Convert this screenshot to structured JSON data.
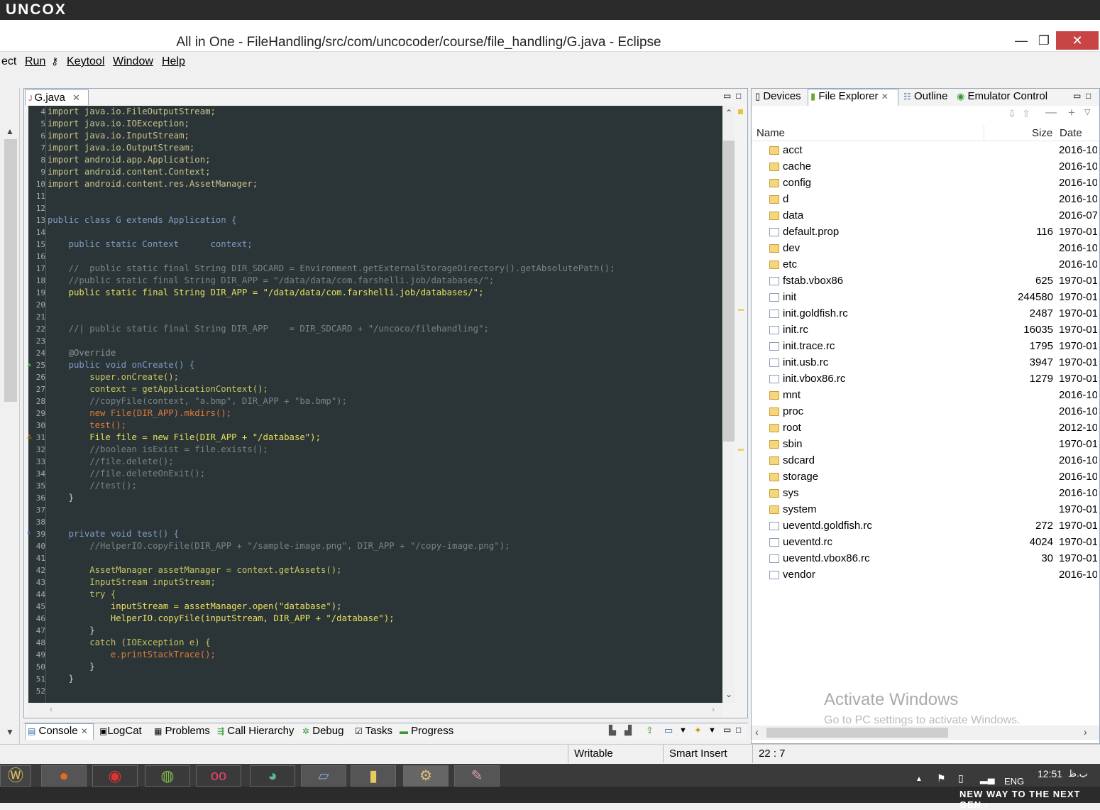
{
  "brand": "uncox",
  "window": {
    "title": "All in One - FileHandling/src/com/uncocoder/course/file_handling/G.java - Eclipse",
    "minimize": "—",
    "maximize": "❐",
    "close": "✕"
  },
  "menu": [
    "ect",
    "Run",
    "Keytool",
    "Window",
    "Help"
  ],
  "editor": {
    "tab_label": "G.java",
    "lines": [
      {
        "n": "4",
        "t": "import java.io.FileOutputStream;"
      },
      {
        "n": "5",
        "t": "import java.io.IOException;"
      },
      {
        "n": "6",
        "t": "import java.io.InputStream;"
      },
      {
        "n": "7",
        "t": "import java.io.OutputStream;"
      },
      {
        "n": "8",
        "t": "import android.app.Application;"
      },
      {
        "n": "9",
        "t": "import android.content.Context;"
      },
      {
        "n": "10",
        "t": "import android.content.res.AssetManager;"
      },
      {
        "n": "11",
        "t": ""
      },
      {
        "n": "12",
        "t": ""
      },
      {
        "n": "13",
        "t": "public class G extends Application {"
      },
      {
        "n": "14",
        "t": ""
      },
      {
        "n": "15",
        "t": "    public static Context      context;"
      },
      {
        "n": "16",
        "t": ""
      },
      {
        "n": "17",
        "t": "    //  public static final String DIR_SDCARD = Environment.getExternalStorageDirectory().getAbsolutePath();"
      },
      {
        "n": "18",
        "t": "    //public static final String DIR_APP = \"/data/data/com.farshelli.job/databases/\";"
      },
      {
        "n": "19",
        "t": "    public static final String DIR_APP = \"/data/data/com.farshelli.job/databases/\";"
      },
      {
        "n": "20",
        "t": ""
      },
      {
        "n": "21",
        "t": ""
      },
      {
        "n": "22",
        "t": "    //| public static final String DIR_APP    = DIR_SDCARD + \"/uncoco/filehandling\";"
      },
      {
        "n": "23",
        "t": ""
      },
      {
        "n": "24",
        "t": "    @Override"
      },
      {
        "n": "25",
        "t": "    public void onCreate() {"
      },
      {
        "n": "26",
        "t": "        super.onCreate();"
      },
      {
        "n": "27",
        "t": "        context = getApplicationContext();"
      },
      {
        "n": "28",
        "t": "        //copyFile(context, \"a.bmp\", DIR_APP + \"ba.bmp\");"
      },
      {
        "n": "29",
        "t": "        new File(DIR_APP).mkdirs();"
      },
      {
        "n": "30",
        "t": "        test();"
      },
      {
        "n": "31",
        "t": "        File file = new File(DIR_APP + \"/database\");"
      },
      {
        "n": "32",
        "t": "        //boolean isExist = file.exists();"
      },
      {
        "n": "33",
        "t": "        //file.delete();"
      },
      {
        "n": "34",
        "t": "        //file.deleteOnExit();"
      },
      {
        "n": "35",
        "t": "        //test();"
      },
      {
        "n": "36",
        "t": "    }"
      },
      {
        "n": "37",
        "t": ""
      },
      {
        "n": "38",
        "t": ""
      },
      {
        "n": "39",
        "t": "    private void test() {"
      },
      {
        "n": "40",
        "t": "        //HelperIO.copyFile(DIR_APP + \"/sample-image.png\", DIR_APP + \"/copy-image.png\");"
      },
      {
        "n": "41",
        "t": ""
      },
      {
        "n": "42",
        "t": "        AssetManager assetManager = context.getAssets();"
      },
      {
        "n": "43",
        "t": "        InputStream inputStream;"
      },
      {
        "n": "44",
        "t": "        try {"
      },
      {
        "n": "45",
        "t": "            inputStream = assetManager.open(\"database\");"
      },
      {
        "n": "46",
        "t": "            HelperIO.copyFile(inputStream, DIR_APP + \"/database\");"
      },
      {
        "n": "47",
        "t": "        }"
      },
      {
        "n": "48",
        "t": "        catch (IOException e) {"
      },
      {
        "n": "49",
        "t": "            e.printStackTrace();"
      },
      {
        "n": "50",
        "t": "        }"
      },
      {
        "n": "51",
        "t": "    }"
      },
      {
        "n": "52",
        "t": ""
      }
    ]
  },
  "right_tabs": [
    "Devices",
    "File Explorer",
    "Outline",
    "Emulator Control"
  ],
  "file_explorer": {
    "columns": [
      "Name",
      "Size",
      "Date"
    ],
    "rows": [
      {
        "name": "acct",
        "size": "",
        "date": "2016-10",
        "type": "folder"
      },
      {
        "name": "cache",
        "size": "",
        "date": "2016-10",
        "type": "folder"
      },
      {
        "name": "config",
        "size": "",
        "date": "2016-10",
        "type": "folder"
      },
      {
        "name": "d",
        "size": "",
        "date": "2016-10",
        "type": "folder"
      },
      {
        "name": "data",
        "size": "",
        "date": "2016-07",
        "type": "folder"
      },
      {
        "name": "default.prop",
        "size": "116",
        "date": "1970-01",
        "type": "file"
      },
      {
        "name": "dev",
        "size": "",
        "date": "2016-10",
        "type": "folder"
      },
      {
        "name": "etc",
        "size": "",
        "date": "2016-10",
        "type": "folder"
      },
      {
        "name": "fstab.vbox86",
        "size": "625",
        "date": "1970-01",
        "type": "file"
      },
      {
        "name": "init",
        "size": "244580",
        "date": "1970-01",
        "type": "file"
      },
      {
        "name": "init.goldfish.rc",
        "size": "2487",
        "date": "1970-01",
        "type": "file"
      },
      {
        "name": "init.rc",
        "size": "16035",
        "date": "1970-01",
        "type": "file"
      },
      {
        "name": "init.trace.rc",
        "size": "1795",
        "date": "1970-01",
        "type": "file"
      },
      {
        "name": "init.usb.rc",
        "size": "3947",
        "date": "1970-01",
        "type": "file"
      },
      {
        "name": "init.vbox86.rc",
        "size": "1279",
        "date": "1970-01",
        "type": "file"
      },
      {
        "name": "mnt",
        "size": "",
        "date": "2016-10",
        "type": "folder"
      },
      {
        "name": "proc",
        "size": "",
        "date": "2016-10",
        "type": "folder"
      },
      {
        "name": "root",
        "size": "",
        "date": "2012-10",
        "type": "folder"
      },
      {
        "name": "sbin",
        "size": "",
        "date": "1970-01",
        "type": "folder"
      },
      {
        "name": "sdcard",
        "size": "",
        "date": "2016-10",
        "type": "folder"
      },
      {
        "name": "storage",
        "size": "",
        "date": "2016-10",
        "type": "folder"
      },
      {
        "name": "sys",
        "size": "",
        "date": "2016-10",
        "type": "folder"
      },
      {
        "name": "system",
        "size": "",
        "date": "1970-01",
        "type": "folder"
      },
      {
        "name": "ueventd.goldfish.rc",
        "size": "272",
        "date": "1970-01",
        "type": "file"
      },
      {
        "name": "ueventd.rc",
        "size": "4024",
        "date": "1970-01",
        "type": "file"
      },
      {
        "name": "ueventd.vbox86.rc",
        "size": "30",
        "date": "1970-01",
        "type": "file"
      },
      {
        "name": "vendor",
        "size": "",
        "date": "2016-10",
        "type": "file"
      }
    ]
  },
  "watermark": {
    "line1": "Activate Windows",
    "line2": "Go to PC settings to activate Windows."
  },
  "bottom_tabs": [
    "Console",
    "LogCat",
    "Problems",
    "Call Hierarchy",
    "Debug",
    "Tasks",
    "Progress"
  ],
  "status": {
    "writable": "Writable",
    "insert_mode": "Smart Insert",
    "position": "22 : 7"
  },
  "taskbar": {
    "clock": "12:51",
    "ampm": "ب.ظ",
    "lang": "ENG"
  },
  "slogan": "NEW WAY TO THE NEXT GEN ›",
  "colors": {
    "editor_bg": "#2b3538",
    "keyword": "#7e9cc5",
    "string": "#e8e05a",
    "comment": "#7a8386",
    "method": "#e07a36",
    "field": "#c9c95a"
  }
}
